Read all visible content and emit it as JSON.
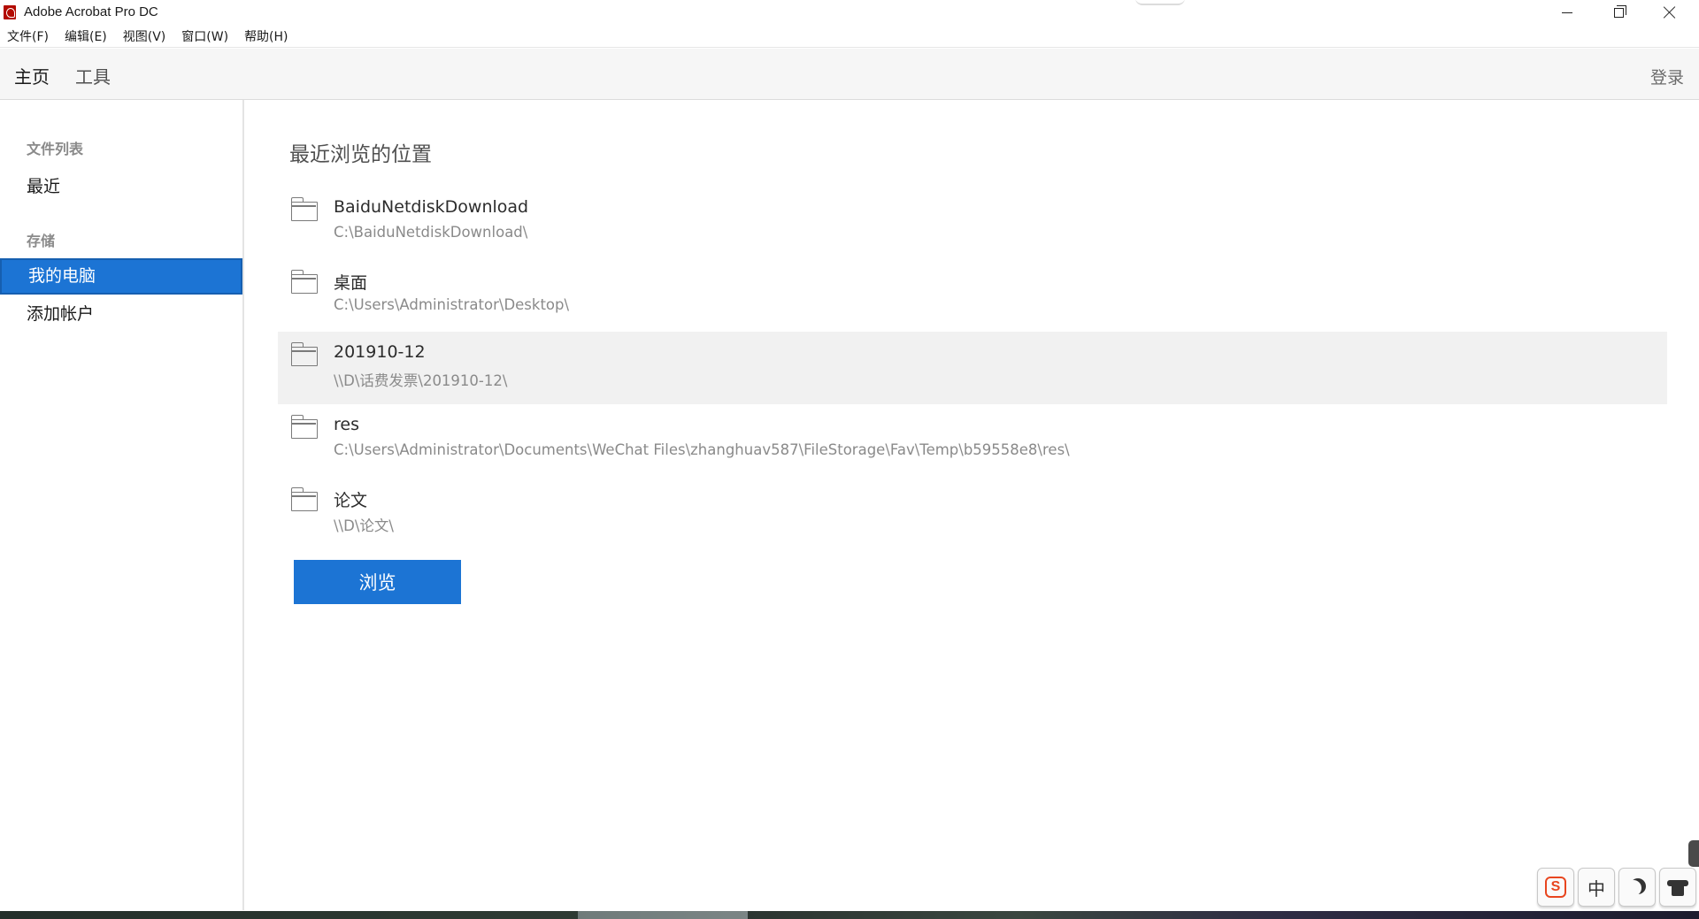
{
  "window": {
    "title": "Adobe Acrobat Pro DC"
  },
  "menubar": {
    "items": [
      "文件(F)",
      "编辑(E)",
      "视图(V)",
      "窗口(W)",
      "帮助(H)"
    ]
  },
  "topnav": {
    "tabs": [
      "主页",
      "工具"
    ],
    "active_tab": "主页",
    "signin_label": "登录"
  },
  "sidebar": {
    "files_heading": "文件列表",
    "recent_label": "最近",
    "storage_heading": "存储",
    "my_computer_label": "我的电脑",
    "add_account_label": "添加帐户",
    "selected": "我的电脑"
  },
  "main": {
    "section_title": "最近浏览的位置",
    "locations": [
      {
        "name": "BaiduNetdiskDownload",
        "path": "C:\\BaiduNetdiskDownload\\"
      },
      {
        "name": "桌面",
        "path": "C:\\Users\\Administrator\\Desktop\\"
      },
      {
        "name": "201910-12",
        "path": "\\\\D\\话费发票\\201910-12\\"
      },
      {
        "name": "res",
        "path": "C:\\Users\\Administrator\\Documents\\WeChat Files\\zhanghuav587\\FileStorage\\Fav\\Temp\\b59558e8\\res\\"
      },
      {
        "name": "论文",
        "path": "\\\\D\\论文\\"
      }
    ],
    "highlighted_location": "201910-12",
    "browse_label": "浏览"
  },
  "ime": {
    "sogou_mark": "S",
    "lang_label": "中"
  },
  "colors": {
    "accent": "#1c74d4",
    "app_icon": "#b30b00",
    "sogou": "#e8461f"
  },
  "icons": [
    "acrobat-app-icon",
    "minimize-icon",
    "maximize-icon",
    "close-icon",
    "folder-icon",
    "sogou-icon",
    "moon-icon",
    "skin-shirt-icon"
  ]
}
